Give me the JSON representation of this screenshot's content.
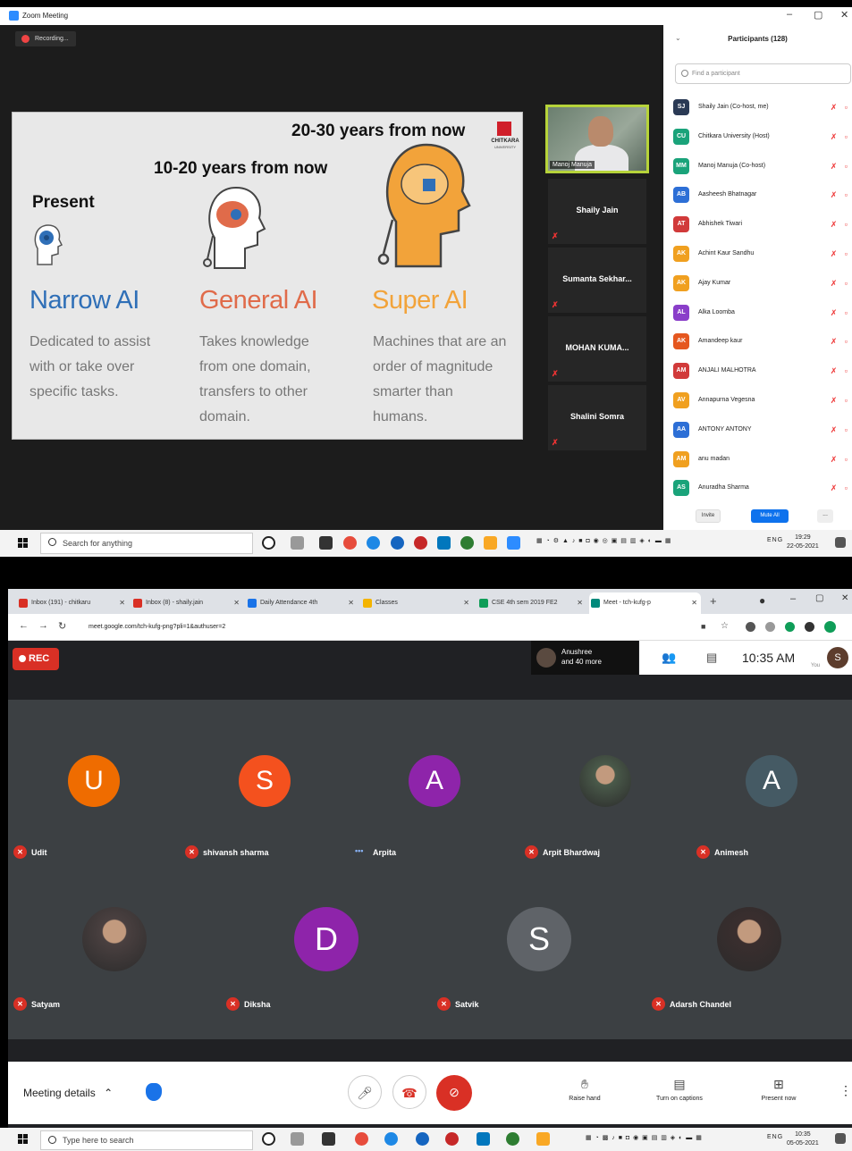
{
  "zoom": {
    "window_title": "Zoom Meeting",
    "recording_label": "Recording...",
    "slide": {
      "levels": [
        {
          "when": "Present",
          "title": "Narrow AI",
          "desc": [
            "Dedicated to assist",
            "with or take over",
            "specific tasks."
          ],
          "color": "#2f6fb7"
        },
        {
          "when": "10-20 years from now",
          "title": "General AI",
          "desc": [
            "Takes knowledge",
            "from one domain,",
            "transfers to other",
            "domain."
          ],
          "color": "#e06b4a"
        },
        {
          "when": "20-30 years from now",
          "title": "Super AI",
          "desc": [
            "Machines that are an",
            "order of magnitude",
            "smarter than",
            "humans."
          ],
          "color": "#f2a33a"
        }
      ],
      "logo_text": "CHITKARA",
      "logo_sub": "UNIVERSITY"
    },
    "active_speaker": "Manoj Manuja",
    "tiles": [
      "Shaily Jain",
      "Sumanta Sekhar...",
      "MOHAN KUMA...",
      "Shalini Somra"
    ],
    "panel": {
      "title": "Participants (128)",
      "search_placeholder": "Find a participant",
      "participants": [
        {
          "initials": "SJ",
          "name": "Shaily Jain (Co-host, me)",
          "color": "#2b3a55"
        },
        {
          "initials": "CU",
          "name": "Chitkara University (Host)",
          "color": "#1aa37a"
        },
        {
          "initials": "MM",
          "name": "Manoj Manuja (Co-host)",
          "color": "#1aa37a"
        },
        {
          "initials": "AB",
          "name": "Aasheesh Bhatnagar",
          "color": "#2d6fd6"
        },
        {
          "initials": "AT",
          "name": "Abhishek Tiwari",
          "color": "#d13a3a"
        },
        {
          "initials": "AK",
          "name": "Achint Kaur Sandhu",
          "color": "#f0a020"
        },
        {
          "initials": "AK",
          "name": "Ajay Kumar",
          "color": "#f0a020"
        },
        {
          "initials": "AL",
          "name": "Alka Loomba",
          "color": "#8a3ec9"
        },
        {
          "initials": "AK",
          "name": "Amandeep kaur",
          "color": "#e5571f"
        },
        {
          "initials": "AM",
          "name": "ANJALI MALHOTRA",
          "color": "#d13a3a"
        },
        {
          "initials": "AV",
          "name": "Annapurna Vegesna",
          "color": "#f0a020"
        },
        {
          "initials": "AA",
          "name": "ANTONY ANTONY",
          "color": "#2d6fd6"
        },
        {
          "initials": "AM",
          "name": "anu madan",
          "color": "#f0a020"
        },
        {
          "initials": "AS",
          "name": "Anuradha Sharma",
          "color": "#1aa37a"
        }
      ],
      "invite_label": "Invite",
      "mute_all_label": "Mute All",
      "more_label": "..."
    }
  },
  "taskbar_top": {
    "search_placeholder": "Search for anything",
    "lang": "ENG",
    "time": "19:29",
    "date": "22-05-2021"
  },
  "meet": {
    "tabs": [
      {
        "label": "Inbox (191) - chitkaru",
        "color": "#d93025"
      },
      {
        "label": "Inbox (8) - shaily.jain",
        "color": "#d93025"
      },
      {
        "label": "Daily Attendance 4th",
        "color": "#1a73e8"
      },
      {
        "label": "Classes",
        "color": "#f4b400"
      },
      {
        "label": "CSE 4th sem 2019 FE2",
        "color": "#0f9d58"
      },
      {
        "label": "Meet - tch-kufg-p",
        "color": "#00897b"
      }
    ],
    "url": "meet.google.com/tch-kufg-png?pli=1&authuser=2",
    "rec_label": "REC",
    "people_popup": [
      "Anushree",
      "and 40 more"
    ],
    "time": "10:35 AM",
    "you_label": "You",
    "me_initial": "S",
    "participants": [
      {
        "name": "Udit",
        "initial": "U",
        "color": "#ef6c00",
        "kind": "avatar"
      },
      {
        "name": "shivansh sharma",
        "initial": "S",
        "color": "#f4511e",
        "kind": "avatar"
      },
      {
        "name": "Arpita",
        "initial": "A",
        "color": "#8e24aa",
        "kind": "avatar"
      },
      {
        "name": "Arpit Bhardwaj",
        "initial": "",
        "color": "#4a5a4a",
        "kind": "photo"
      },
      {
        "name": "Animesh",
        "initial": "A",
        "color": "#455a64",
        "kind": "avatar"
      },
      {
        "name": "Satyam",
        "initial": "",
        "color": "#4a4040",
        "kind": "photo"
      },
      {
        "name": "Diksha",
        "initial": "D",
        "color": "#8e24aa",
        "kind": "avatar"
      },
      {
        "name": "Satvik",
        "initial": "S",
        "color": "#5f6368",
        "kind": "avatar"
      },
      {
        "name": "Adarsh Chandel",
        "initial": "",
        "color": "#3a2e2e",
        "kind": "photo"
      }
    ],
    "meeting_details": "Meeting details",
    "actions": [
      "Raise hand",
      "Turn on captions",
      "Present now"
    ]
  },
  "taskbar_bottom": {
    "search_placeholder": "Type here to search",
    "lang": "ENG",
    "time": "10:35",
    "date": "05-05-2021"
  }
}
